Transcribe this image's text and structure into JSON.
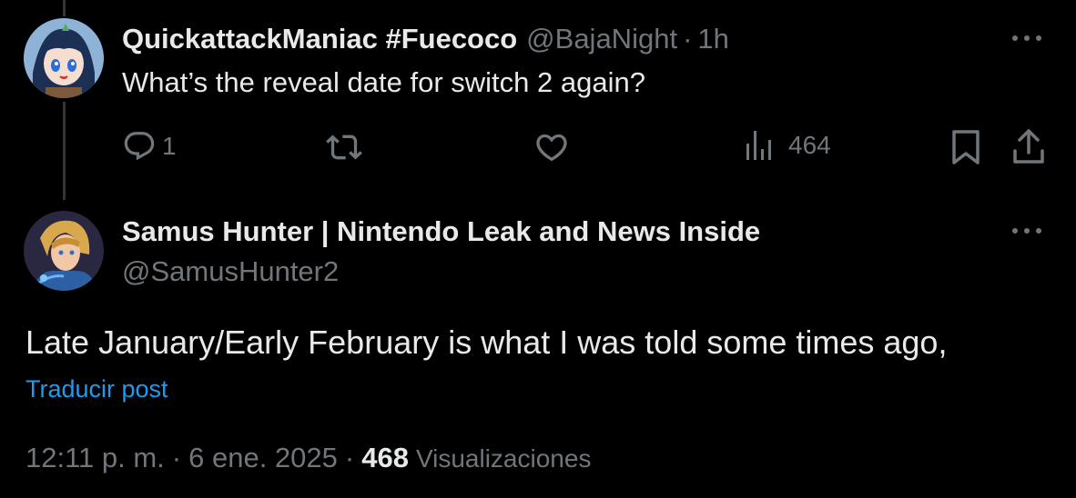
{
  "tweet_1": {
    "display_name": "QuickattackManiac #Fuecoco",
    "handle": "@BajaNight",
    "separator": "·",
    "time": "1h",
    "text": "What’s the reveal date for switch 2 again?",
    "actions": {
      "reply_icon": "reply-icon",
      "reply_count": "1",
      "retweet_icon": "retweet-icon",
      "like_icon": "heart-icon",
      "views_icon": "views-chart-icon",
      "views_count": "464",
      "bookmark_icon": "bookmark-icon",
      "share_icon": "share-icon"
    },
    "more_icon": "more-horizontal-icon"
  },
  "tweet_2": {
    "display_name": "Samus Hunter | Nintendo Leak and News Inside",
    "handle": "@SamusHunter2",
    "text": "Late January/Early February is what I was told some times ago,",
    "translate_link": "Traducir post",
    "timestamp": "12:11 p. m.",
    "date": "6 ene. 2025",
    "separator": "·",
    "views_count": "468",
    "views_label": "Visualizaciones",
    "more_icon": "more-horizontal-icon"
  },
  "colors": {
    "background": "#000000",
    "primary_text": "#e7e9ea",
    "secondary_text": "#71767b",
    "link": "#1d9bf0",
    "thread_line": "#333639"
  }
}
